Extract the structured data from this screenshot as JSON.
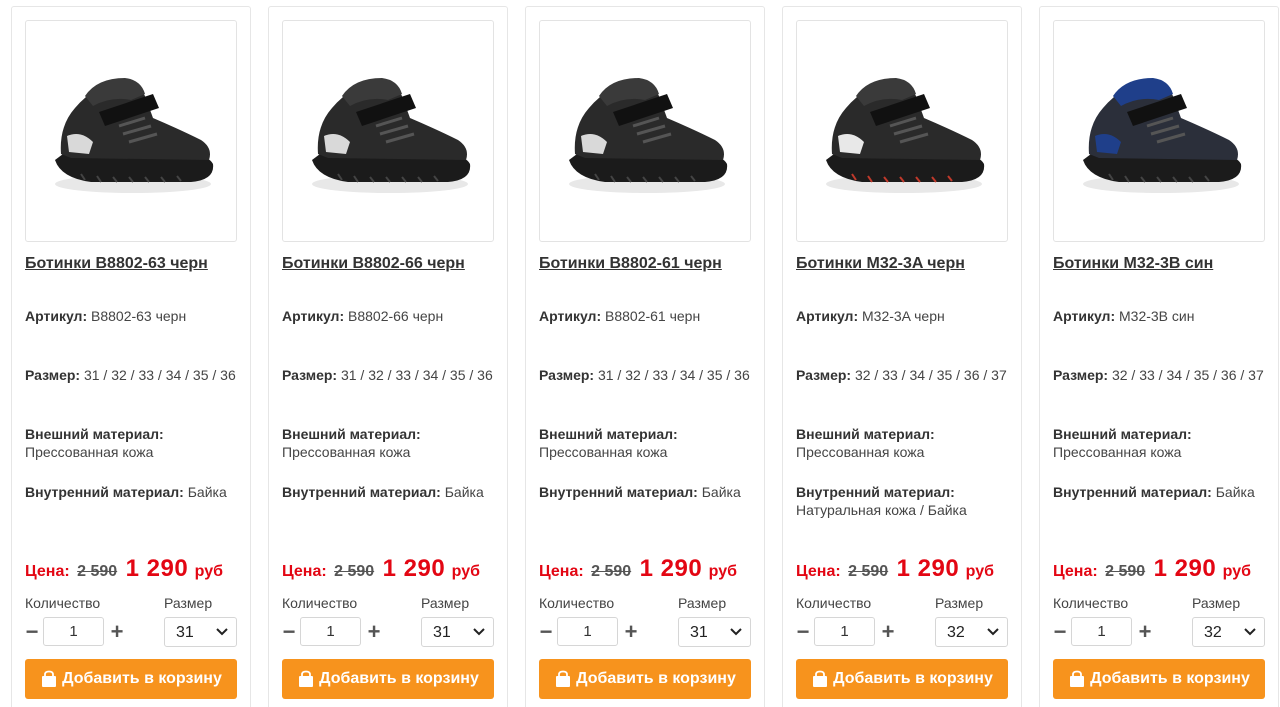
{
  "labels": {
    "article": "Артикул:",
    "size": "Размер:",
    "outer": "Внешний материал:",
    "inner": "Внутренний материал:",
    "price": "Цена:",
    "currency": "руб",
    "quantity": "Количество",
    "size_select": "Размер",
    "add_to_cart": "Добавить в корзину"
  },
  "products": [
    {
      "title": "Ботинки B8802-63 черн",
      "article": "B8802-63 черн",
      "sizes": "31 / 32 / 33 / 34 / 35 / 36",
      "outer": "Прессованная кожа",
      "inner": "Байка",
      "old_price": "2 590",
      "new_price": "1 290",
      "quantity": "1",
      "selected_size": "31",
      "image": "shoe-photo-black"
    },
    {
      "title": "Ботинки B8802-66 черн",
      "article": "B8802-66 черн",
      "sizes": "31 / 32 / 33 / 34 / 35 / 36",
      "outer": "Прессованная кожа",
      "inner": "Байка",
      "old_price": "2 590",
      "new_price": "1 290",
      "quantity": "1",
      "selected_size": "31",
      "image": "shoe-photo-black"
    },
    {
      "title": "Ботинки B8802-61 черн",
      "article": "B8802-61 черн",
      "sizes": "31 / 32 / 33 / 34 / 35 / 36",
      "outer": "Прессованная кожа",
      "inner": "Байка",
      "old_price": "2 590",
      "new_price": "1 290",
      "quantity": "1",
      "selected_size": "31",
      "image": "shoe-photo-black"
    },
    {
      "title": "Ботинки M32-3A черн",
      "article": "M32-3A черн",
      "sizes": "32 / 33 / 34 / 35 / 36 / 37",
      "outer": "Прессованная кожа",
      "inner": "Натуральная кожа / Байка",
      "old_price": "2 590",
      "new_price": "1 290",
      "quantity": "1",
      "selected_size": "32",
      "image": "shoe-photo-black-red"
    },
    {
      "title": "Ботинки M32-3B син",
      "article": "M32-3B син",
      "sizes": "32 / 33 / 34 / 35 / 36 / 37",
      "outer": "Прессованная кожа",
      "inner": "Байка",
      "old_price": "2 590",
      "new_price": "1 290",
      "quantity": "1",
      "selected_size": "32",
      "image": "shoe-photo-blue"
    }
  ],
  "colors": {
    "price_red": "#e30613",
    "cart_orange": "#f7931d",
    "shoe_black": "#222222",
    "shoe_blue": "#1f3f8a",
    "shoe_red_accent": "#c0392b"
  }
}
